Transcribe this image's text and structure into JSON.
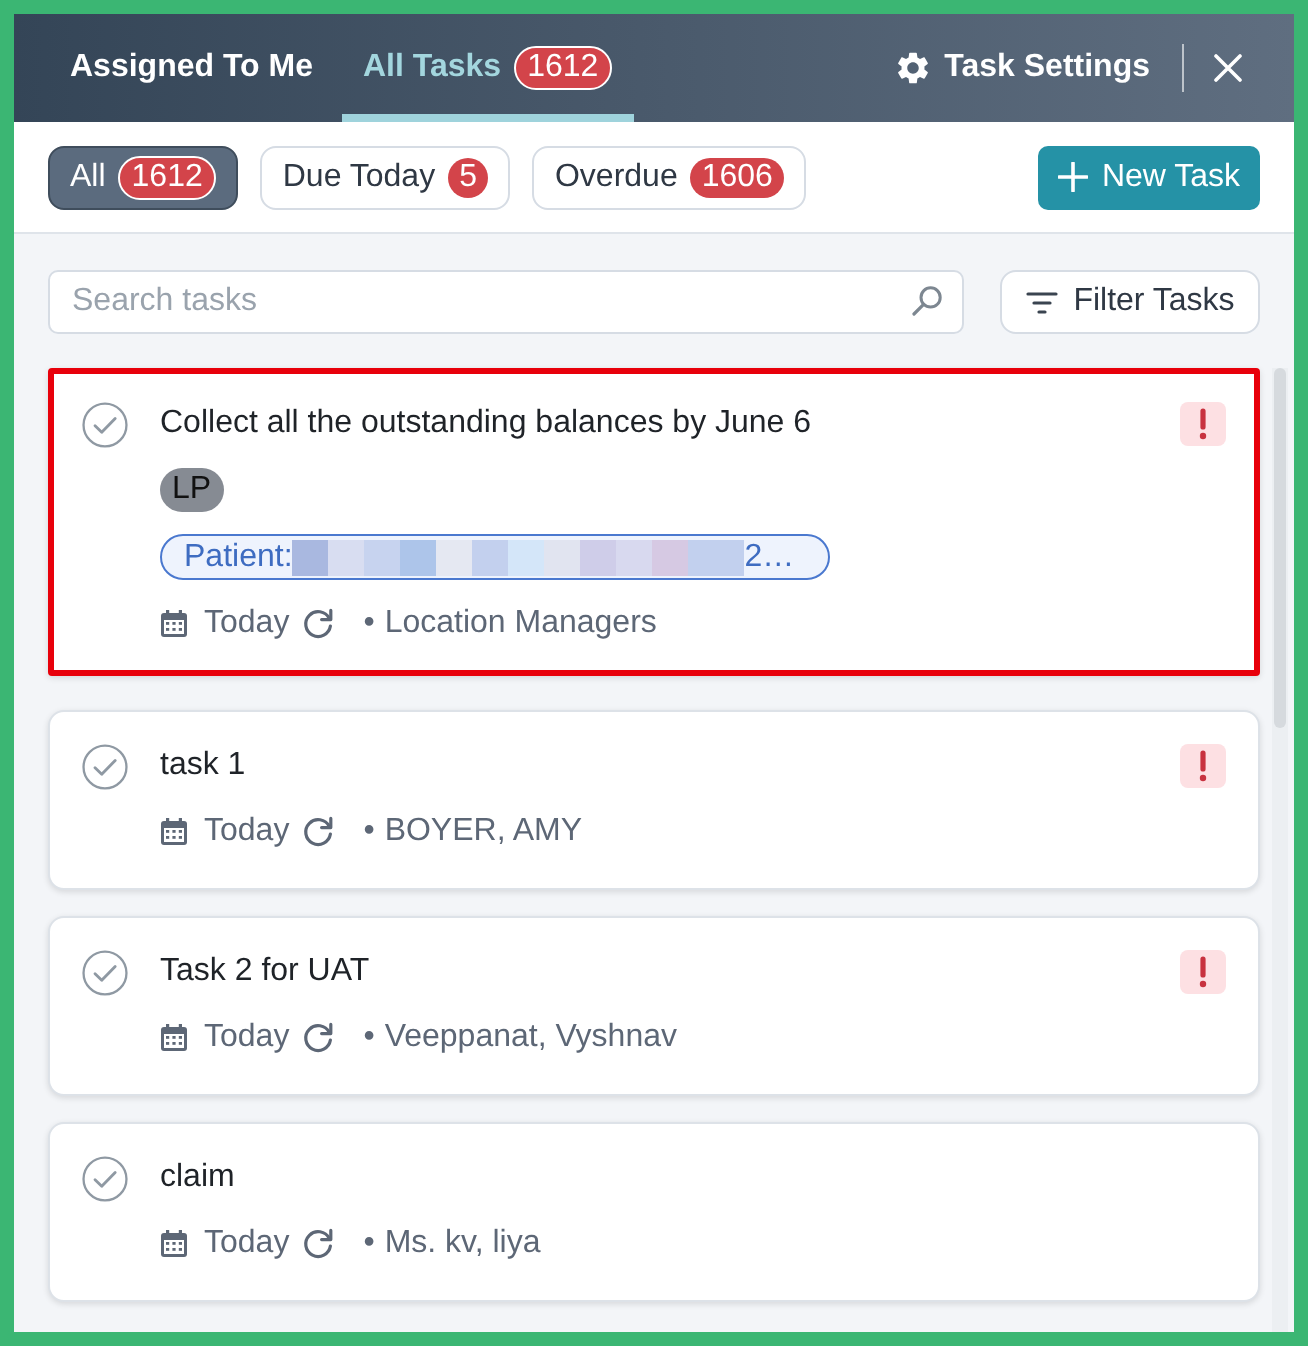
{
  "header": {
    "tabs": [
      {
        "label": "Assigned To Me",
        "selected": false
      },
      {
        "label": "All Tasks",
        "count": "1612",
        "selected": true
      }
    ],
    "settings_label": "Task Settings"
  },
  "filters": [
    {
      "label": "All",
      "count": "1612",
      "selected": true
    },
    {
      "label": "Due Today",
      "count": "5",
      "selected": false
    },
    {
      "label": "Overdue",
      "count": "1606",
      "selected": false
    }
  ],
  "new_task_label": "New Task",
  "search": {
    "placeholder": "Search tasks"
  },
  "filter_button_label": "Filter Tasks",
  "tasks": [
    {
      "title": "Collect all the outstanding balances by June 6",
      "highlighted": true,
      "high_priority": true,
      "tags": [
        {
          "kind": "initials",
          "label": "LP"
        },
        {
          "kind": "patient",
          "label": "Patient:",
          "redacted": true,
          "tail": "2…"
        }
      ],
      "due": "Today",
      "recurring": true,
      "separator": "•",
      "assignee": "Location Managers"
    },
    {
      "title": "task 1",
      "highlighted": false,
      "high_priority": true,
      "due": "Today",
      "recurring": true,
      "separator": "•",
      "assignee": "BOYER, AMY"
    },
    {
      "title": "Task 2 for UAT",
      "highlighted": false,
      "high_priority": true,
      "due": "Today",
      "recurring": true,
      "separator": "•",
      "assignee": "Veeppanat, Vyshnav"
    },
    {
      "title": "claim",
      "highlighted": false,
      "high_priority": false,
      "due": "Today",
      "recurring": true,
      "separator": "•",
      "assignee": "Ms. kv, liya"
    }
  ]
}
